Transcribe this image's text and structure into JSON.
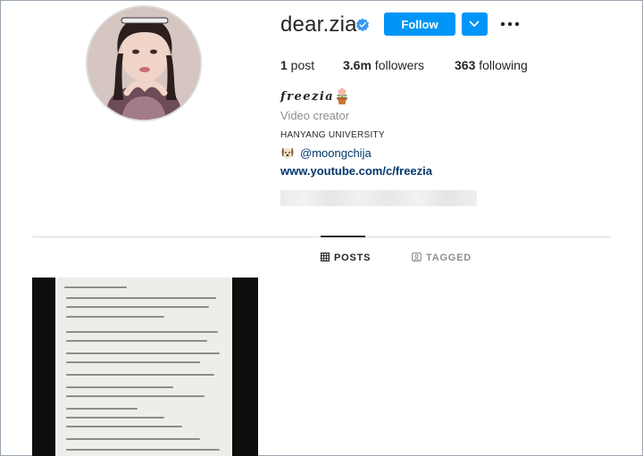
{
  "profile": {
    "username": "dear.zia",
    "verified": true,
    "follow_label": "Follow",
    "stats": {
      "posts_count": "1",
      "posts_label": " post",
      "followers_count": "3.6m",
      "followers_label": " followers",
      "following_count": "363",
      "following_label": " following"
    },
    "full_name": "𝒇𝒓𝒆𝒆𝒛𝒊𝒂 .",
    "category": "Video creator",
    "bio_line1": "HANYANG UNIVERSITY",
    "bio_handle": "@moongchija",
    "website": "www.youtube.com/c/freezia"
  },
  "tabs": [
    {
      "label": "POSTS",
      "active": true,
      "icon": "grid-icon"
    },
    {
      "label": "TAGGED",
      "active": false,
      "icon": "tagged-icon"
    }
  ],
  "colors": {
    "primary_blue": "#0095f6",
    "link_blue": "#00376b",
    "secondary_text": "#8e8e8e",
    "verified_blue": "#3897f0"
  }
}
